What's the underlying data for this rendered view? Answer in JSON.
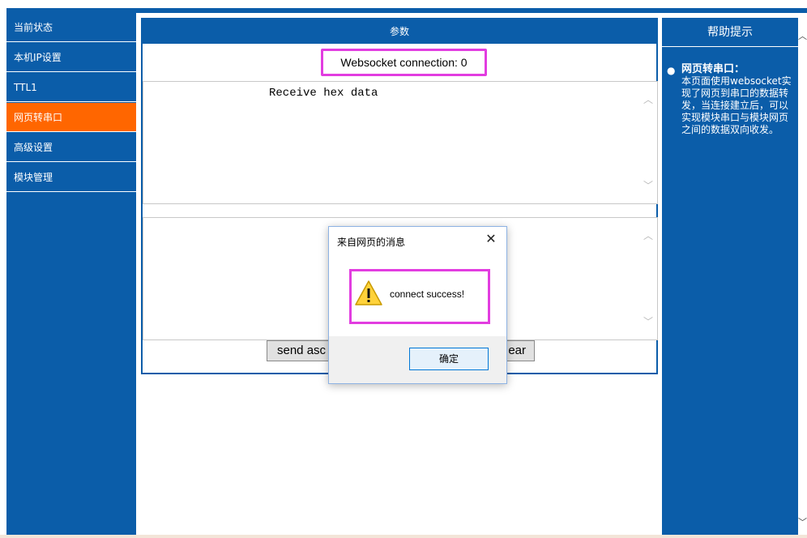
{
  "sidebar": {
    "items": [
      {
        "label": "当前状态"
      },
      {
        "label": "本机IP设置"
      },
      {
        "label": "TTL1"
      },
      {
        "label": "网页转串口",
        "active": true
      },
      {
        "label": "高级设置"
      },
      {
        "label": "模块管理"
      }
    ]
  },
  "main": {
    "title": "参数",
    "connection_status": "Websocket connection: 0",
    "receive_text": "Receive hex data",
    "send_button_label": "send asc",
    "clear_button_label": "ear"
  },
  "help": {
    "title": "帮助提示",
    "heading": "网页转串口：",
    "body": "本页面使用websocket实现了网页到串口的数据转发，当连接建立后，可以实现模块串口与模块网页之间的数据双向收发。"
  },
  "dialog": {
    "title": "来自网页的消息",
    "message": "connect success!",
    "ok_label": "确定",
    "icon": "warning-icon"
  },
  "colors": {
    "primary_blue": "#0b5da9",
    "active_orange": "#ff6600",
    "highlight_magenta": "#e23de0"
  }
}
